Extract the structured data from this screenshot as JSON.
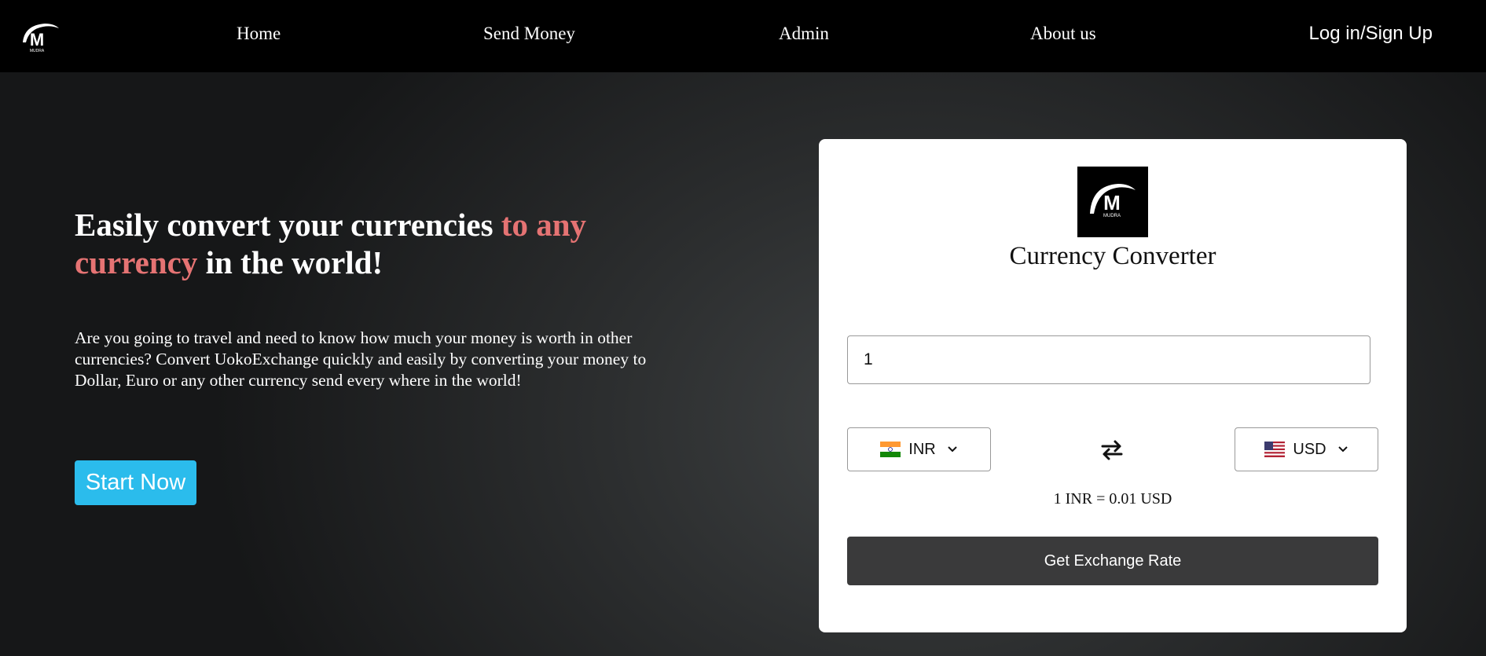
{
  "nav": {
    "logo_text": "MUDRA",
    "logo_letter": "M",
    "links": [
      "Home",
      "Send Money",
      "Admin",
      "About us"
    ],
    "login_label": "Log in/Sign Up"
  },
  "hero": {
    "headline_part1": "Easily convert your currencies ",
    "headline_accent": "to any currency",
    "headline_part2": " in the world!",
    "description": "Are you going to travel and need to know how much your money is worth in other currencies? Convert UokoExchange quickly and easily by converting your money to Dollar, Euro or any other currency send every where in the world!",
    "start_label": "Start Now"
  },
  "converter": {
    "title": "Currency Converter",
    "amount": "1",
    "from_currency": "INR",
    "to_currency": "USD",
    "rate_text": "1 INR = 0.01 USD",
    "button_label": "Get Exchange Rate"
  },
  "icons": {
    "logo": "mudra-logo",
    "swap": "swap-arrows-icon",
    "from_flag": "india-flag-icon",
    "to_flag": "us-flag-icon",
    "chevron": "chevron-down-icon"
  },
  "colors": {
    "accent_red": "#e57373",
    "start_button": "#2bbcec",
    "rate_button": "#3a3a3b",
    "navbar": "#000000"
  }
}
